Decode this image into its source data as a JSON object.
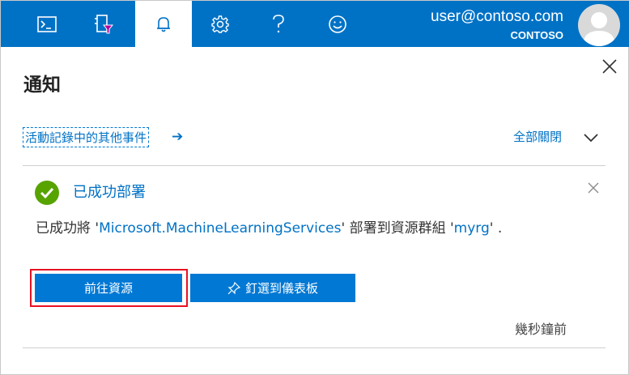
{
  "topbar": {
    "icons": [
      "terminal-icon",
      "filter-icon",
      "bell-icon",
      "gear-icon",
      "help-icon",
      "smiley-icon"
    ],
    "active": "bell-icon",
    "user_email": "user@contoso.com",
    "user_org": "CONTOSO",
    "accent_color": "#0072c6"
  },
  "panel": {
    "title": "通知",
    "activity_link": "活動記錄中的其他事件",
    "close_all": "全部關閉"
  },
  "notification": {
    "title": "已成功部署",
    "message": {
      "prefix": "已成功將 '",
      "resource": "Microsoft.MachineLearningServices",
      "middle": "' 部署到資源群組 '",
      "group": "myrg",
      "suffix": "' ."
    },
    "go_to_resource": "前往資源",
    "pin_to_dashboard": "釘選到儀表板",
    "timestamp": "幾秒鐘前",
    "status_color": "#57a300"
  }
}
